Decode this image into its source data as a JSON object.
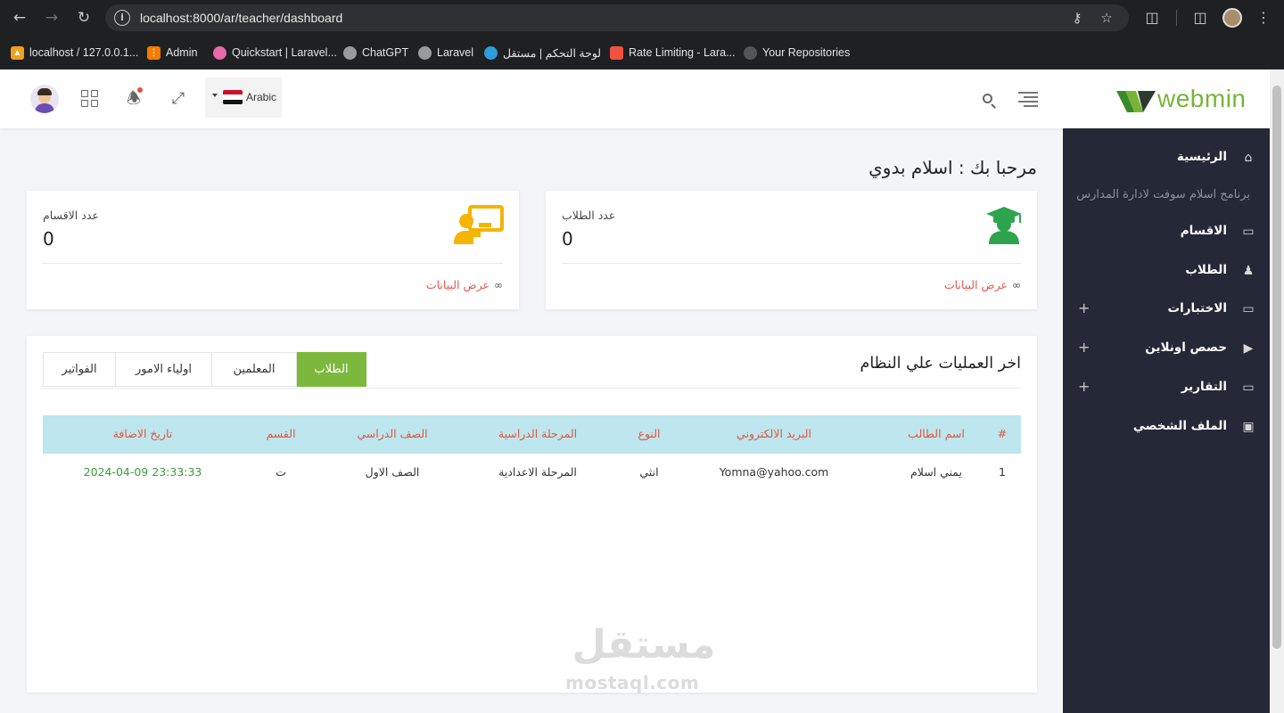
{
  "browser": {
    "url": "localhost:8000/ar/teacher/dashboard",
    "bookmarks": [
      {
        "label": "localhost / 127.0.0.1...",
        "icon": "phpmyadmin-icon",
        "color": "#f0a020"
      },
      {
        "label": "Admin",
        "icon": "xampp-icon",
        "color": "#f57c00"
      },
      {
        "label": "Quickstart | Laravel...",
        "icon": "livewire-icon",
        "color": "#e86aa8"
      },
      {
        "label": "ChatGPT",
        "icon": "chatgpt-icon",
        "color": "#9a9a9a"
      },
      {
        "label": "Laravel",
        "icon": "globe-icon",
        "color": "#9a9a9a"
      },
      {
        "label": "لوحة التحكم | مستقل",
        "icon": "mostaql-icon",
        "color": "#2d9cdb"
      },
      {
        "label": "Rate Limiting - Lara...",
        "icon": "laravel-icon",
        "color": "#f05340"
      },
      {
        "label": "Your Repositories",
        "icon": "github-icon",
        "color": "#555555"
      }
    ]
  },
  "header": {
    "language": "Arabic",
    "logo_text": "webmin"
  },
  "sidebar": {
    "caption": "برنامج اسلام سوفت لادارة المدارس",
    "items": [
      {
        "label": "الرئيسية",
        "icon": "home-icon",
        "expandable": false
      },
      {
        "label": "الاقسام",
        "icon": "laptop-icon",
        "expandable": false
      },
      {
        "label": "الطلاب",
        "icon": "student-icon",
        "expandable": false
      },
      {
        "label": "الاختبارات",
        "icon": "laptop-icon",
        "expandable": true
      },
      {
        "label": "حصص اونلاين",
        "icon": "video-icon",
        "expandable": true
      },
      {
        "label": "التقارير",
        "icon": "laptop-icon",
        "expandable": true
      },
      {
        "label": "الملف الشخصي",
        "icon": "id-card-icon",
        "expandable": false
      }
    ]
  },
  "main": {
    "welcome": "مرحبا بك : اسلام بدوي",
    "cards": [
      {
        "label": "عدد الطلاب",
        "value": "0",
        "link": "عرض البيانات",
        "icon": "graduate-icon",
        "color": "#2ea44f"
      },
      {
        "label": "عدد الاقسام",
        "value": "0",
        "link": "عرض البيانات",
        "icon": "classroom-icon",
        "color": "#f5b400"
      }
    ],
    "panel": {
      "title": "اخر العمليات علي النظام",
      "tabs": [
        "الطلاب",
        "المعلمين",
        "اولياء الامور",
        "الفواتير"
      ],
      "active_tab": "الطلاب",
      "columns": [
        "#",
        "اسم الطالب",
        "البريد الالكتروني",
        "النوع",
        "المرحلة الدراسية",
        "الصف الدراسي",
        "القسم",
        "تاريخ الاضافة"
      ],
      "rows": [
        [
          "1",
          "يمني اسلام",
          "Yomna@yahoo.com",
          "انثي",
          "المرحلة الاعدادية",
          "الصف الاول",
          "ت",
          "2024-04-09 23:33:33"
        ]
      ]
    }
  },
  "watermark": {
    "arabic": "مستقل",
    "latin": "mostaql.com"
  }
}
